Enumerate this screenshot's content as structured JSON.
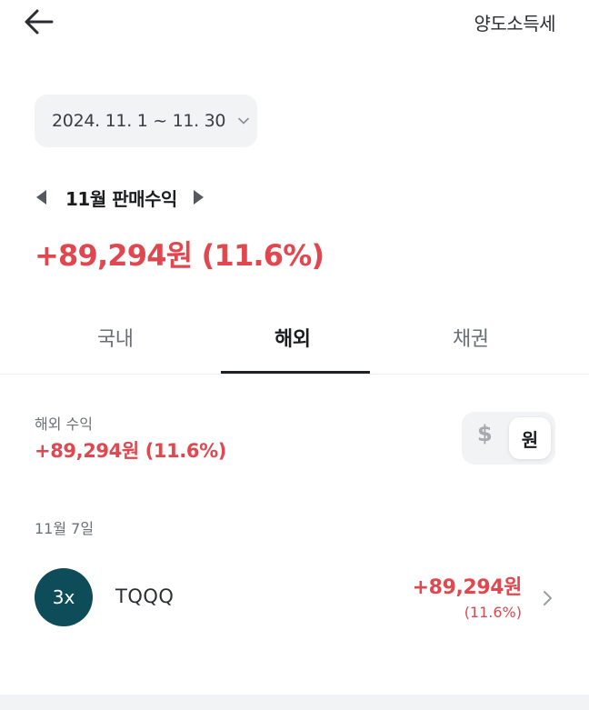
{
  "header": {
    "title_right": "양도소득세"
  },
  "date_range": {
    "label": "2024. 11. 1 ~ 11. 30"
  },
  "month_nav": {
    "label": "11월 판매수익"
  },
  "total": {
    "profit_text": "+89,294원 (11.6%)"
  },
  "tabs": [
    {
      "label": "국내",
      "active": false
    },
    {
      "label": "해외",
      "active": true
    },
    {
      "label": "채권",
      "active": false
    }
  ],
  "overseas": {
    "label": "해외 수익",
    "value": "+89,294원 (11.6%)"
  },
  "currency_toggle": {
    "usd": "$",
    "krw": "원",
    "selected": "원"
  },
  "trades_group": {
    "date": "11월 7일",
    "items": [
      {
        "logo_text": "3x",
        "ticker": "TQQQ",
        "amount": "+89,294원",
        "rate": "(11.6%)"
      }
    ]
  },
  "colors": {
    "profit_red": "#e0474e",
    "logo_teal": "#0e4c5a",
    "pill_bg": "#f2f3f5"
  }
}
